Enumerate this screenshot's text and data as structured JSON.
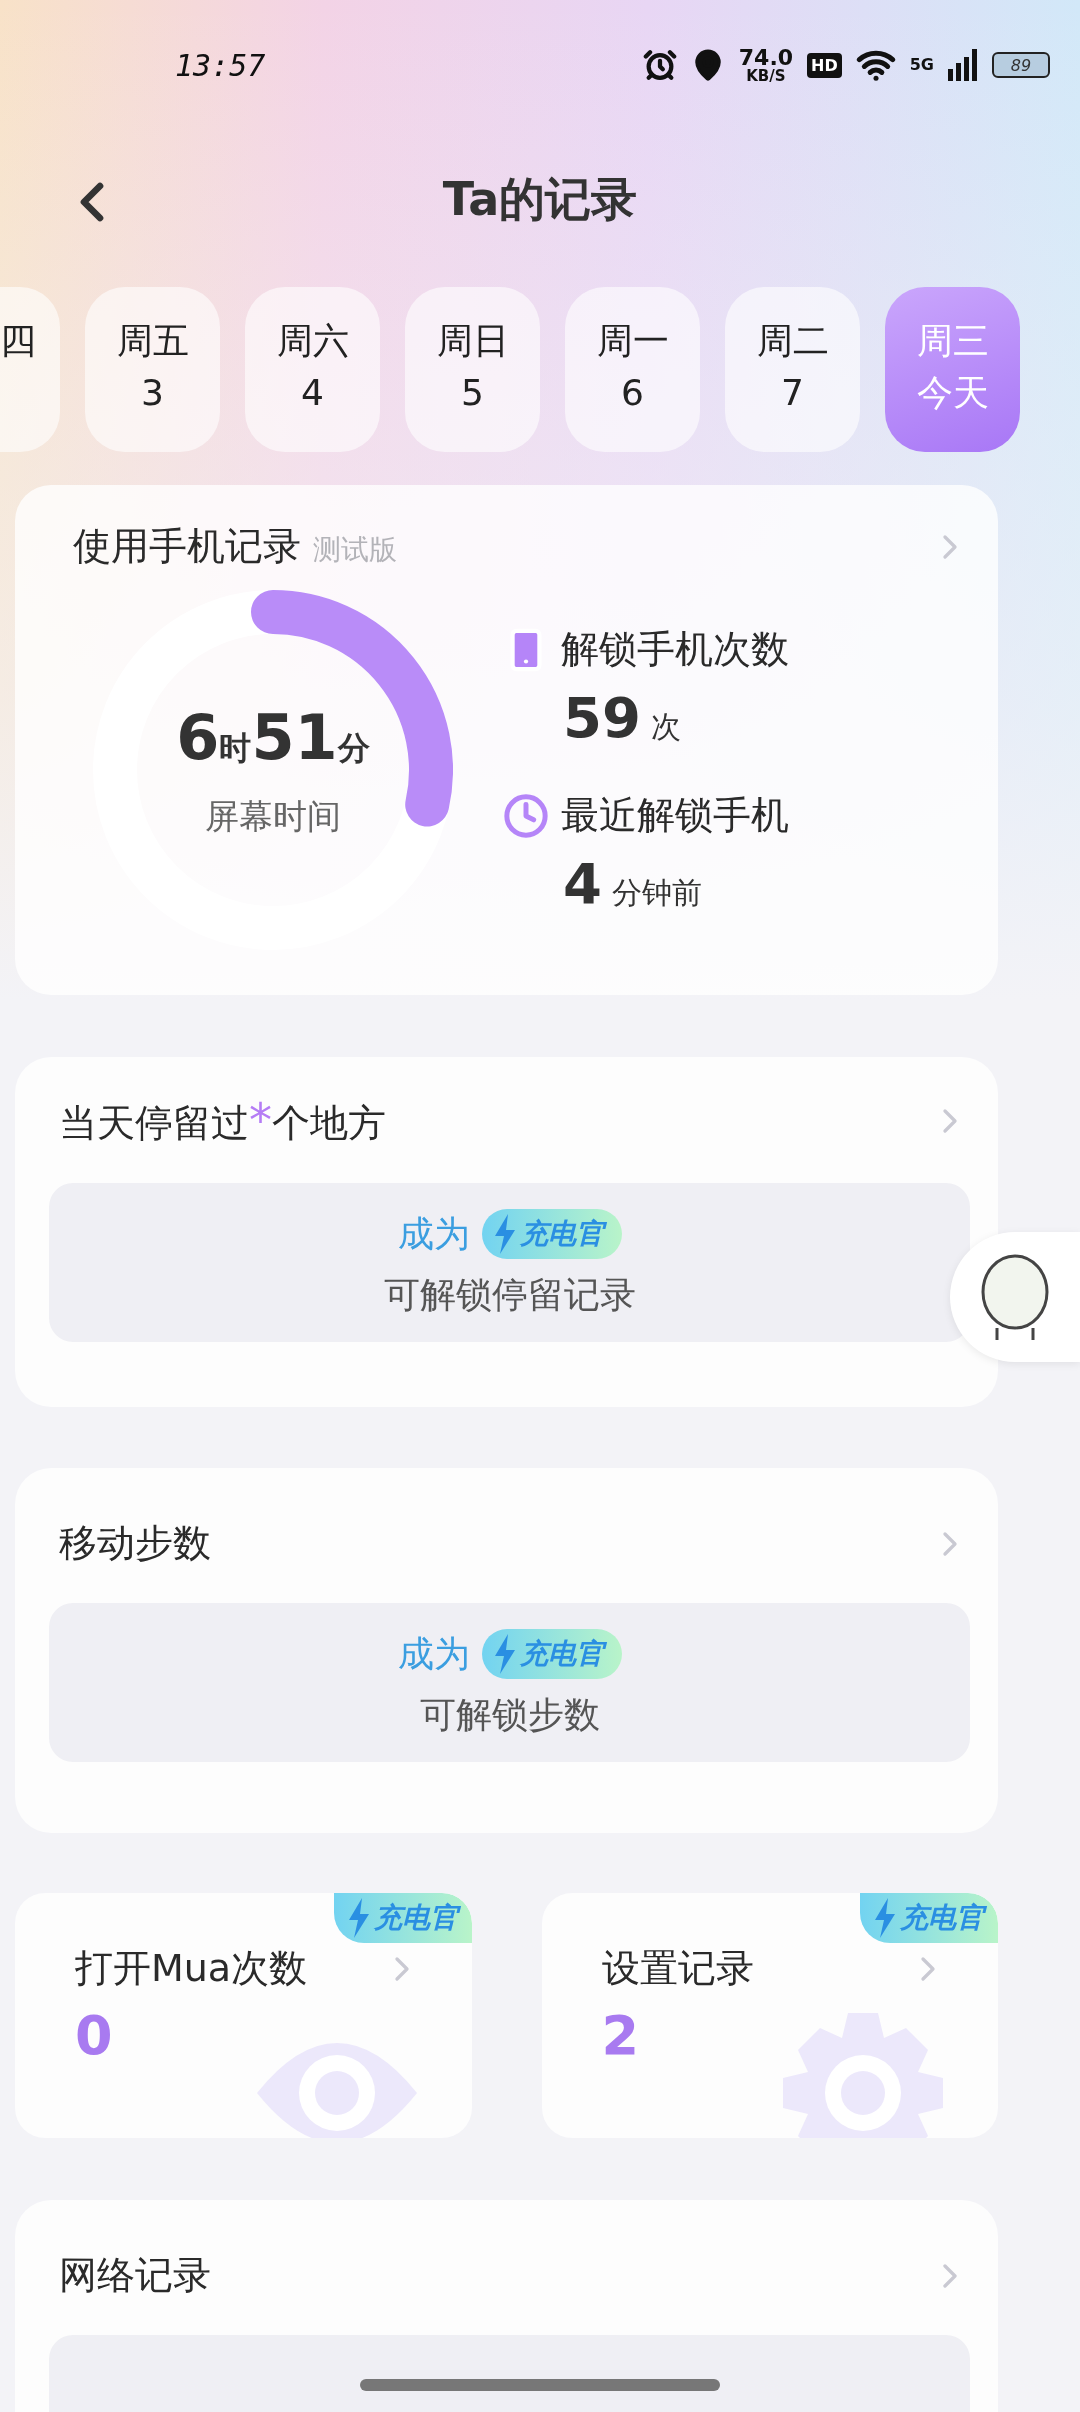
{
  "status_bar": {
    "time": "13:57",
    "net_speed": "74.0",
    "net_unit": "KB/S",
    "hd": "HD",
    "network": "5G",
    "battery": "89"
  },
  "header": {
    "title": "Ta的记录"
  },
  "days": [
    {
      "weekday": "四",
      "selected": false
    },
    {
      "weekday": "周五",
      "date": "3",
      "selected": false
    },
    {
      "weekday": "周六",
      "date": "4",
      "selected": false
    },
    {
      "weekday": "周日",
      "date": "5",
      "selected": false
    },
    {
      "weekday": "周一",
      "date": "6",
      "selected": false
    },
    {
      "weekday": "周二",
      "date": "7",
      "selected": false
    },
    {
      "weekday": "周三",
      "date": "今天",
      "selected": true
    }
  ],
  "phone_usage": {
    "title": "使用手机记录",
    "tag": "测试版",
    "screen_time": {
      "hours": "6",
      "hours_unit": "时",
      "minutes": "51",
      "minutes_unit": "分",
      "label": "屏幕时间"
    },
    "stats": [
      {
        "kind": "phone",
        "label": "解锁手机次数",
        "value": "59",
        "unit": "次"
      },
      {
        "kind": "clock",
        "label": "最近解锁手机",
        "value": "4",
        "unit": "分钟前"
      }
    ]
  },
  "places": {
    "title": "当天停留过",
    "mark": "*",
    "title_end": "个地方",
    "lock": {
      "prefix": "成为",
      "badge": "充电官",
      "text": "可解锁停留记录"
    }
  },
  "steps": {
    "title": "移动步数",
    "lock": {
      "prefix": "成为",
      "badge": "充电官",
      "text": "可解锁步数"
    }
  },
  "small_cards": [
    {
      "kind": "eye",
      "title": "打开Mua次数",
      "value": "0",
      "badge": "充电官"
    },
    {
      "kind": "gear",
      "title": "设置记录",
      "value": "2",
      "badge": "充电官"
    }
  ],
  "network": {
    "title": "网络记录"
  }
}
